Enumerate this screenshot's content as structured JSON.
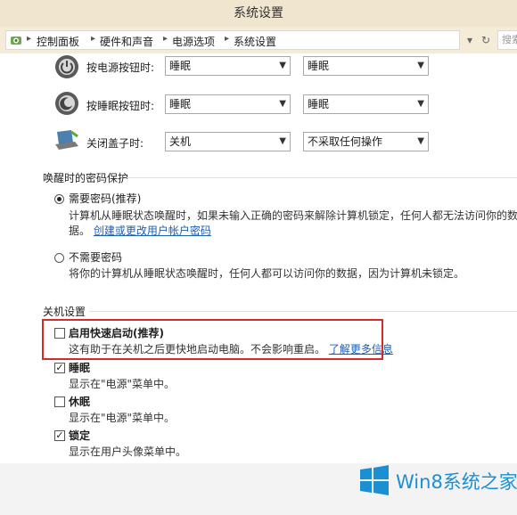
{
  "window": {
    "title": "系统设置"
  },
  "address": {
    "crumbs": [
      "控制面板",
      "硬件和声音",
      "电源选项",
      "系统设置"
    ],
    "search_placeholder": "搜索"
  },
  "buttons_section": {
    "power_button_label": "按电源按钮时:",
    "power_button_battery": "睡眠",
    "power_button_plugged": "睡眠",
    "sleep_button_label": "按睡眠按钮时:",
    "sleep_button_battery": "睡眠",
    "sleep_button_plugged": "睡眠",
    "lid_label": "关闭盖子时:",
    "lid_battery": "关机",
    "lid_plugged": "不采取任何操作"
  },
  "password_section": {
    "title": "唤醒时的密码保护",
    "require_label": "需要密码(推荐)",
    "require_desc_line1": "计算机从睡眠状态唤醒时，如果未输入正确的密码来解除计算机锁定，任何人都无法访问你的数",
    "require_desc_line2": "据。",
    "require_link": "创建或更改用户帐户密码",
    "norequire_label": "不需要密码",
    "norequire_desc": "将你的计算机从睡眠状态唤醒时，任何人都可以访问你的数据，因为计算机未锁定。"
  },
  "shutdown_section": {
    "title": "关机设置",
    "fast_startup_label": "启用快速启动(推荐)",
    "fast_startup_desc": "这有助于在关机之后更快地启动电脑。不会影响重启。",
    "fast_startup_link": "了解更多信息",
    "sleep_label": "睡眠",
    "sleep_desc": "显示在\"电源\"菜单中。",
    "hibernate_label": "休眠",
    "hibernate_desc": "显示在\"电源\"菜单中。",
    "lock_label": "锁定",
    "lock_desc": "显示在用户头像菜单中。"
  },
  "watermark": {
    "brand": "Win8系统之家"
  },
  "colors": {
    "highlight": "#d52b2b",
    "link": "#1a5fb4",
    "brand": "#1b8fd4"
  }
}
